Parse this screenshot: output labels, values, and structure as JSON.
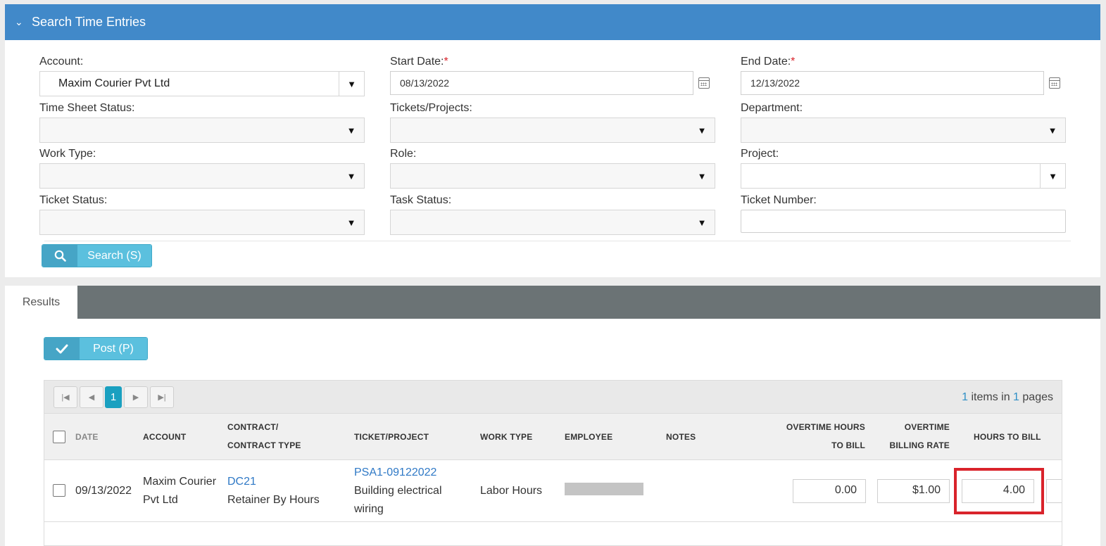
{
  "search": {
    "header_title": "Search Time Entries",
    "fields": {
      "account": {
        "label": "Account:",
        "value": "Maxim Courier Pvt Ltd"
      },
      "start_date": {
        "label": "Start Date:",
        "required_mark": "*",
        "value": "08/13/2022"
      },
      "end_date": {
        "label": "End Date:",
        "required_mark": "*",
        "value": "12/13/2022"
      },
      "time_sheet_status": {
        "label": "Time Sheet Status:"
      },
      "tickets_projects": {
        "label": "Tickets/Projects:"
      },
      "department": {
        "label": "Department:"
      },
      "work_type": {
        "label": "Work Type:"
      },
      "role": {
        "label": "Role:"
      },
      "project": {
        "label": "Project:"
      },
      "ticket_status": {
        "label": "Ticket Status:"
      },
      "task_status": {
        "label": "Task Status:"
      },
      "ticket_number": {
        "label": "Ticket Number:"
      }
    },
    "search_button": "Search (S)"
  },
  "results": {
    "tab_label": "Results",
    "post_button": "Post (P)",
    "pager": {
      "current_page": "1",
      "items_count": "1",
      "items_text": " items in ",
      "pages_count": "1",
      "pages_text": " pages"
    },
    "columns": {
      "date": "DATE",
      "account": "ACCOUNT",
      "contract_1": "CONTRACT/",
      "contract_2": "CONTRACT TYPE",
      "ticket_project": "TICKET/PROJECT",
      "work_type": "WORK TYPE",
      "employee": "EMPLOYEE",
      "notes": "NOTES",
      "ot_hours_1": "OVERTIME HOURS",
      "ot_hours_2": "TO BILL",
      "ot_rate_1": "OVERTIME",
      "ot_rate_2": "BILLING RATE",
      "hours_to_bill": "HOURS TO BILL"
    },
    "rows": [
      {
        "date": "09/13/2022",
        "account_1": "Maxim Courier",
        "account_2": "Pvt Ltd",
        "contract": "DC21",
        "contract_type": "Retainer By Hours",
        "ticket": "PSA1-09122022",
        "ticket_title_1": "Building electrical",
        "ticket_title_2": "wiring",
        "work_type": "Labor Hours",
        "overtime_hours": "0.00",
        "overtime_rate": "$1.00",
        "hours_to_bill": "4.00"
      }
    ]
  },
  "colors": {
    "header_blue": "#4189c9",
    "button_teal": "#5bc0de",
    "link_blue": "#2f79c6",
    "highlight_red": "#d9232b",
    "tab_bar_gray": "#6b7375"
  }
}
